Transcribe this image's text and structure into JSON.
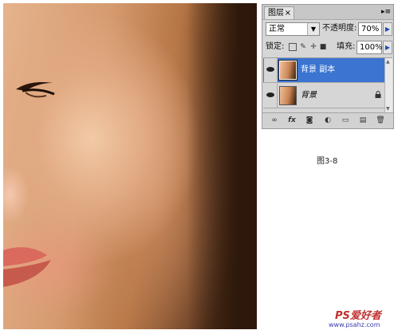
{
  "layers_panel": {
    "tab_label": "图层",
    "tab_close": "×",
    "menu_glyph": "▸≡",
    "blend_mode": "正常",
    "opacity_label": "不透明度:",
    "opacity_value": "70%",
    "lock_label": "锁定:",
    "fill_label": "填充:",
    "fill_value": "100%",
    "layers": [
      {
        "name": "背景 副本",
        "selected": true,
        "visible": true,
        "locked": false
      },
      {
        "name": "背景",
        "selected": false,
        "visible": true,
        "locked": true
      }
    ],
    "toolbar_icons": [
      "link-icon",
      "fx-icon",
      "mask-icon",
      "adjustment-icon",
      "group-folder-icon",
      "new-layer-icon",
      "trash-icon"
    ]
  },
  "caption": "图3-8",
  "watermark": {
    "logo_text": "PS爱好者",
    "url_text": "www.psahz.com"
  },
  "colors": {
    "selection_blue": "#3b74d1",
    "panel_gray": "#d6d6d6",
    "watermark_red": "#c03030"
  }
}
